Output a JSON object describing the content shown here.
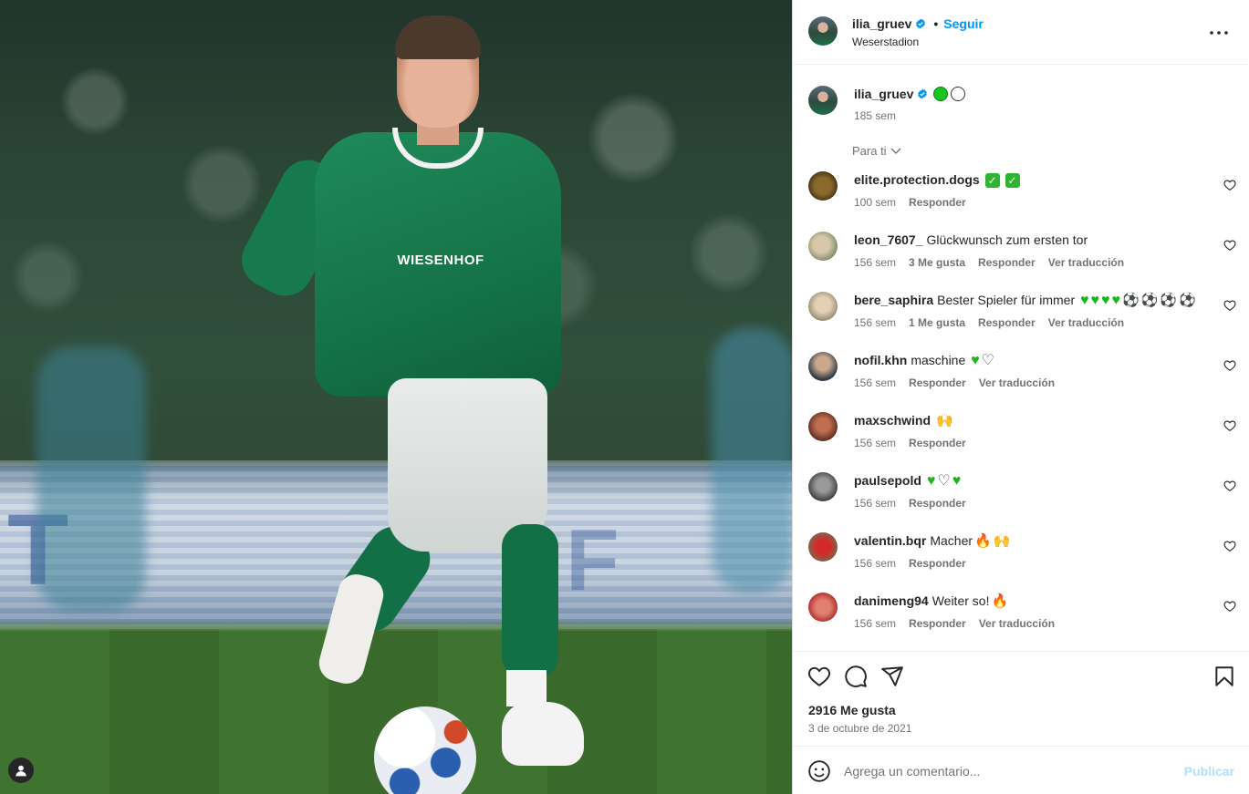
{
  "header": {
    "username": "ilia_gruev",
    "follow_label": "Seguir",
    "separator": "•",
    "location": "Weserstadion"
  },
  "caption": {
    "username": "ilia_gruev",
    "time": "185 sem"
  },
  "sort_label": "Para ti",
  "comments": [
    {
      "user": "elite.protection.dogs",
      "text": "",
      "time": "100 sem",
      "likes": "",
      "reply": "Responder",
      "translate": ""
    },
    {
      "user": "leon_7607_",
      "text": "Glückwunsch zum ersten tor",
      "time": "156 sem",
      "likes": "3 Me gusta",
      "reply": "Responder",
      "translate": "Ver traducción"
    },
    {
      "user": "bere_saphira",
      "text": "Bester Spieler für immer",
      "time": "156 sem",
      "likes": "1 Me gusta",
      "reply": "Responder",
      "translate": "Ver traducción"
    },
    {
      "user": "nofil.khn",
      "text": "maschine",
      "time": "156 sem",
      "likes": "",
      "reply": "Responder",
      "translate": "Ver traducción"
    },
    {
      "user": "maxschwind",
      "text": "",
      "time": "156 sem",
      "likes": "",
      "reply": "Responder",
      "translate": ""
    },
    {
      "user": "paulsepold",
      "text": "",
      "time": "156 sem",
      "likes": "",
      "reply": "Responder",
      "translate": ""
    },
    {
      "user": "valentin.bqr",
      "text": "Macher",
      "time": "156 sem",
      "likes": "",
      "reply": "Responder",
      "translate": ""
    },
    {
      "user": "danimeng94",
      "text": "Weiter so!",
      "time": "156 sem",
      "likes": "",
      "reply": "Responder",
      "translate": "Ver traducción"
    }
  ],
  "stats": {
    "likes": "2916 Me gusta",
    "date": "3 de octubre de 2021"
  },
  "comment_box": {
    "placeholder": "Agrega un comentario...",
    "publish_label": "Publicar"
  },
  "photo": {
    "sponsor": "WIESENHOF"
  },
  "icons": {
    "verified": "verified-badge-icon",
    "more": "more-options-icon",
    "like": "heart-icon",
    "comment": "comment-icon",
    "share": "share-icon",
    "save": "bookmark-icon",
    "emoji": "smiley-icon"
  },
  "colors": {
    "accent": "#0095f6",
    "publish_disabled": "#b2dffc",
    "muted_text": "#737373"
  }
}
